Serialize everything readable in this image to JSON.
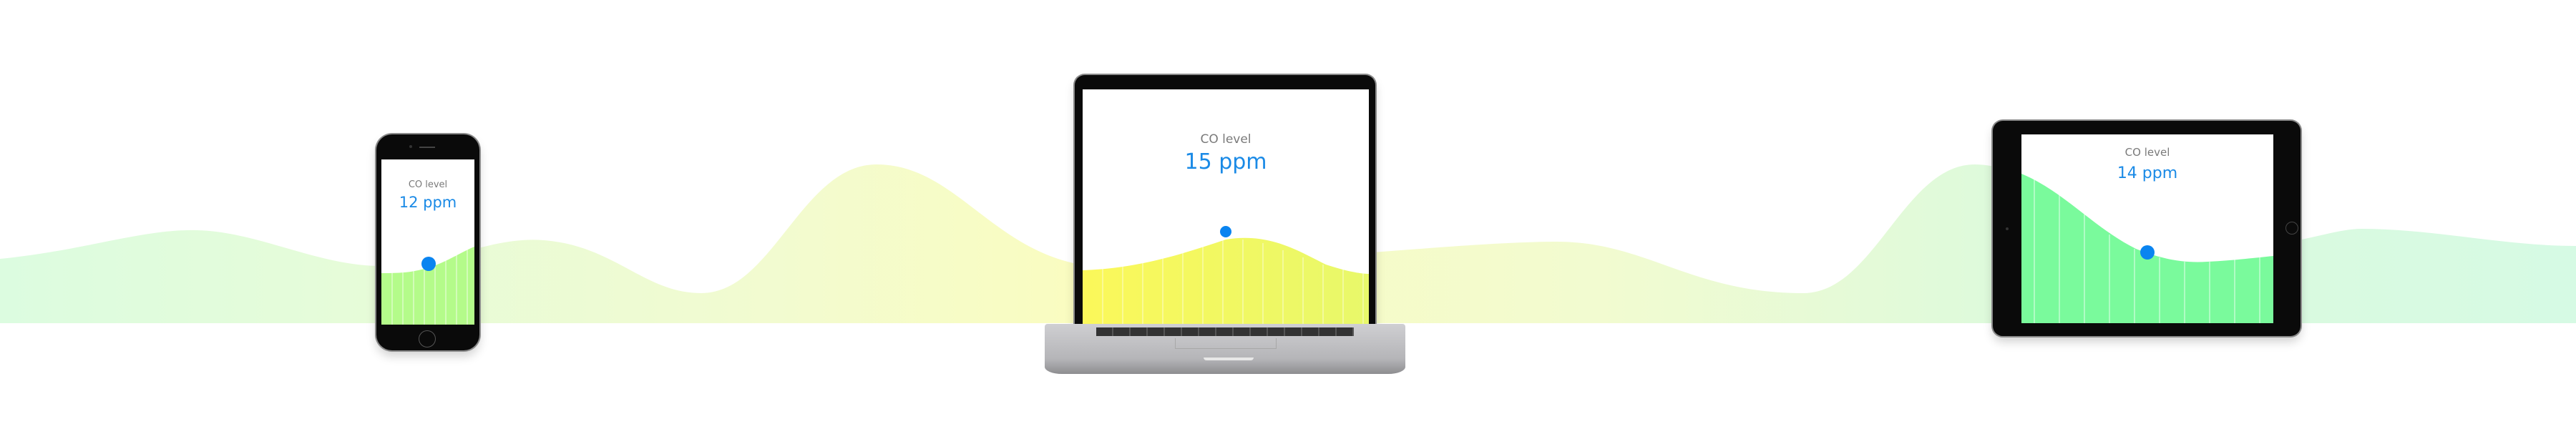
{
  "colors": {
    "accent": "#0a84f0",
    "label": "#7a7a7a",
    "value": "#1a8ae6",
    "band_green": "#d8fbdc",
    "band_yellow": "#f6fbc6",
    "laptop_fill": "#f4fa5c",
    "phone_fill": "#b4fb8a",
    "tablet_fill": "#7afa9c"
  },
  "devices": {
    "phone": {
      "label": "CO level",
      "value": "12 ppm"
    },
    "laptop": {
      "label": "CO level",
      "value": "15 ppm"
    },
    "tablet": {
      "label": "CO level",
      "value": "14 ppm"
    }
  }
}
